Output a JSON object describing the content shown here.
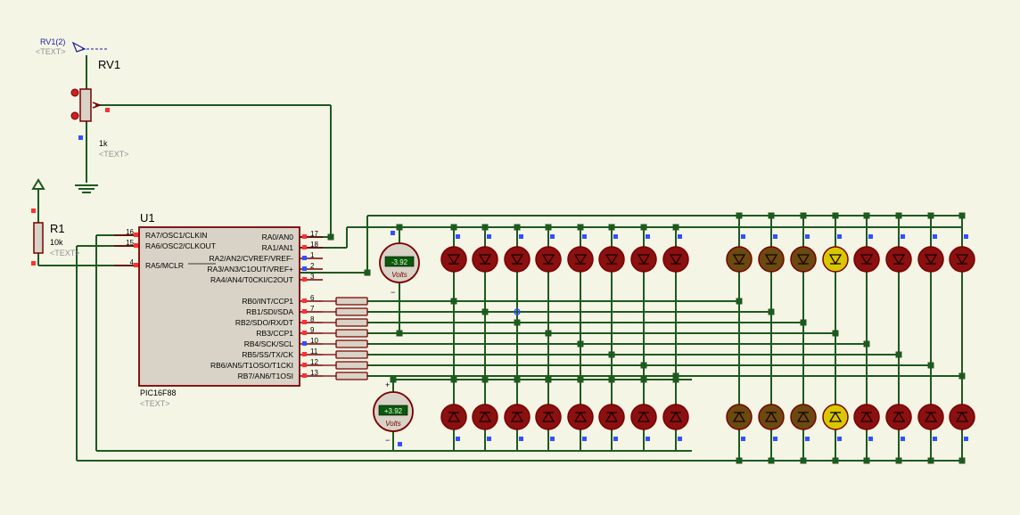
{
  "colors": {
    "background": "#f5f5e6",
    "wire": "#1e5a1e",
    "component": "#7a0000",
    "component_fill": "#d8d3c6",
    "pin_red": "#ff3030",
    "pin_blue": "#3050ff",
    "led_off": "#8b1010",
    "led_dim": "#6b4a10",
    "led_on": "#d8c800",
    "label_blue": "#1a1aa0",
    "text_gray": "#909090",
    "meter_bg": "#0a5a0a",
    "meter_text": "#e8ffe8"
  },
  "rv1": {
    "probe_label": "RV1(2)",
    "probe_text": "<TEXT>",
    "name": "RV1",
    "value": "1k",
    "value_text": "<TEXT>"
  },
  "r1": {
    "name": "R1",
    "value": "10k",
    "text": "<TEXT>"
  },
  "u1": {
    "name": "U1",
    "part": "PIC16F88",
    "part_text": "<TEXT>",
    "left_pins": [
      {
        "num": "16",
        "label": "RA7/OSC1/CLKIN"
      },
      {
        "num": "15",
        "label": "RA6/OSC2/CLKOUT"
      },
      {
        "num": "4",
        "label": "RA5/MCLR"
      }
    ],
    "right_pins": [
      {
        "num": "17",
        "label": "RA0/AN0"
      },
      {
        "num": "18",
        "label": "RA1/AN1"
      },
      {
        "num": "1",
        "label": "RA2/AN2/CVREF/VREF-"
      },
      {
        "num": "2",
        "label": "RA3/AN3/C1OUT/VREF+"
      },
      {
        "num": "3",
        "label": "RA4/AN4/T0CKI/C2OUT"
      },
      {
        "num": "6",
        "label": "RB0/INT/CCP1"
      },
      {
        "num": "7",
        "label": "RB1/SDI/SDA"
      },
      {
        "num": "8",
        "label": "RB2/SDO/RX/DT"
      },
      {
        "num": "9",
        "label": "RB3/CCP1"
      },
      {
        "num": "10",
        "label": "RB4/SCK/SCL"
      },
      {
        "num": "11",
        "label": "RB5/SS/TX/CK"
      },
      {
        "num": "12",
        "label": "RB6/AN5/T1OSO/T1CKI"
      },
      {
        "num": "13",
        "label": "RB7/AN6/T1OSI"
      }
    ]
  },
  "voltmeters": [
    {
      "reading": "-3.92",
      "unit": "Volts",
      "plus": "+",
      "minus": "−"
    },
    {
      "reading": "+3.92",
      "unit": "Volts",
      "plus": "+",
      "minus": "−"
    }
  ],
  "leds": {
    "top_row": [
      "off",
      "off",
      "off",
      "off",
      "off",
      "off",
      "off",
      "off",
      "dim",
      "dim",
      "dim",
      "on",
      "off",
      "off",
      "off",
      "off"
    ],
    "bottom_row": [
      "off",
      "off",
      "off",
      "off",
      "off",
      "off",
      "off",
      "off",
      "dim",
      "dim",
      "dim",
      "on",
      "off",
      "off",
      "off",
      "off"
    ]
  }
}
